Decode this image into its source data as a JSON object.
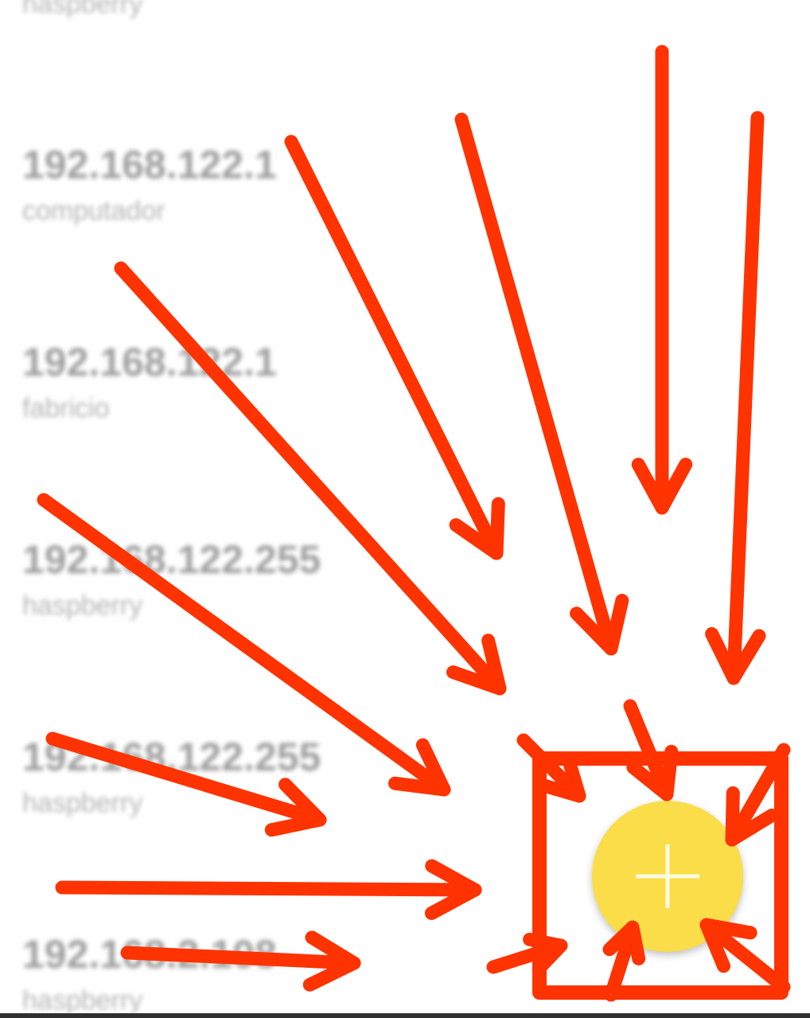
{
  "devices": [
    {
      "ip": "",
      "host": "haspberry"
    },
    {
      "ip": "192.168.122.1",
      "host": "computador"
    },
    {
      "ip": "192.168.122.1",
      "host": "fabricio"
    },
    {
      "ip": "192.168.122.255",
      "host": "haspberry"
    },
    {
      "ip": "192.168.122.255",
      "host": "haspberry"
    },
    {
      "ip": "192.168.2.108",
      "host": "haspberry"
    }
  ],
  "fab": {
    "icon": "plus-icon",
    "color": "#fbdd4a",
    "icon_color": "#fffbe0"
  },
  "annotation": {
    "color": "#ff3300",
    "arrow_count": 18,
    "highlight_shape": "square"
  }
}
